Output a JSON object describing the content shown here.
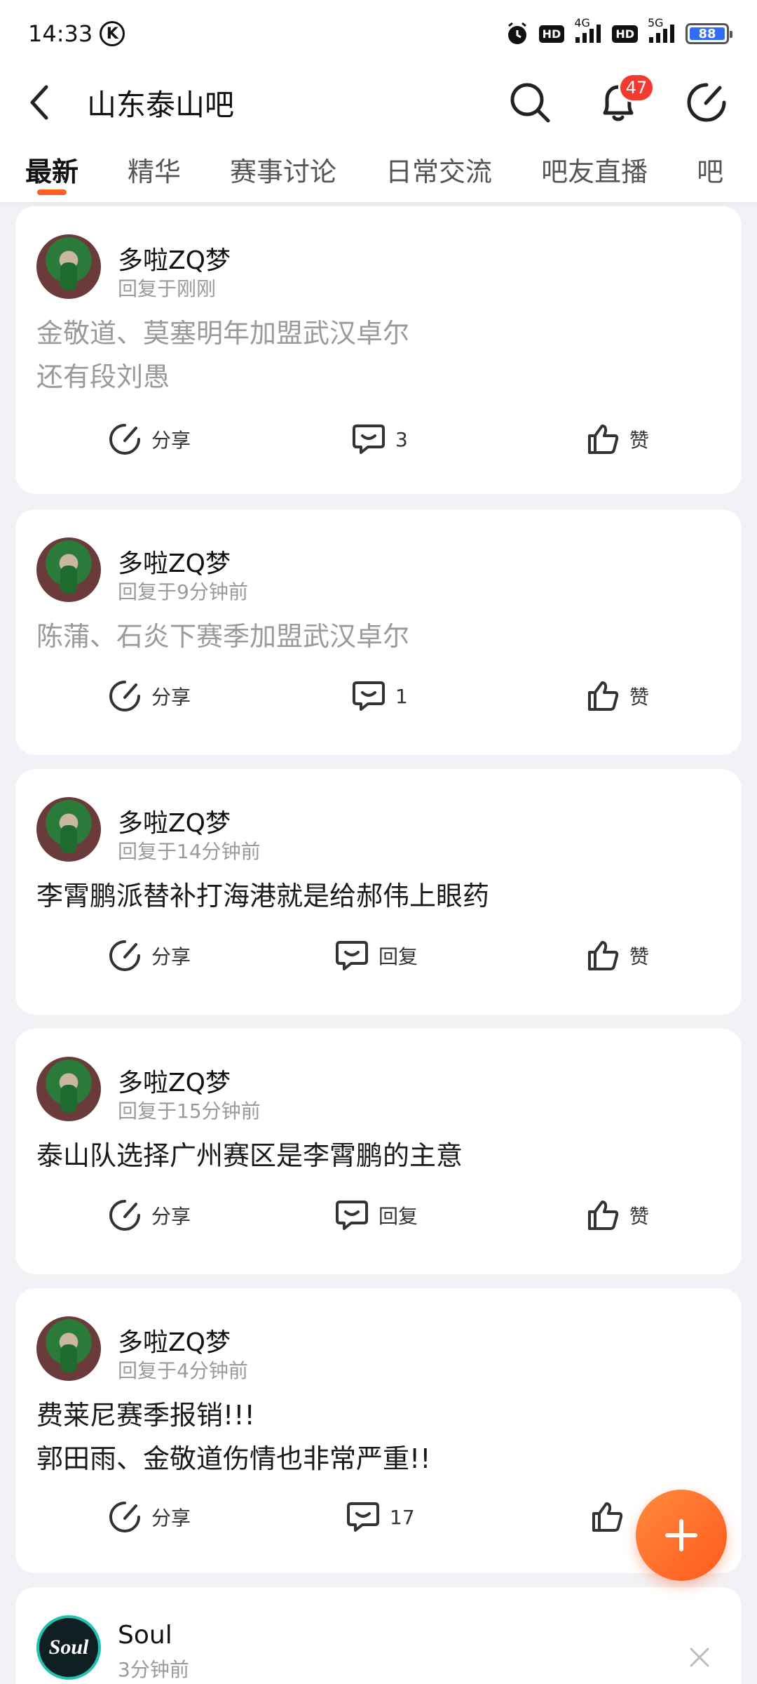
{
  "status_bar": {
    "time": "14:33",
    "k_badge": "K",
    "hd1": "HD",
    "net1": "4G",
    "hd2": "HD",
    "net2": "5G",
    "battery": "88"
  },
  "header": {
    "title": "山东泰山吧",
    "notification_count": "47"
  },
  "tabs": [
    "最新",
    "精华",
    "赛事讨论",
    "日常交流",
    "吧友直播",
    "吧"
  ],
  "posts": [
    {
      "username": "多啦ZQ梦",
      "meta": "回复于刚刚",
      "lines": [
        "金敬道、莫塞明年加盟武汉卓尔",
        "还有段刘愚"
      ],
      "share": "分享",
      "comment": "3",
      "like": "赞"
    },
    {
      "username": "多啦ZQ梦",
      "meta": "回复于9分钟前",
      "lines": [
        "陈蒲、石炎下赛季加盟武汉卓尔"
      ],
      "share": "分享",
      "comment": "1",
      "like": "赞"
    },
    {
      "username": "多啦ZQ梦",
      "meta": "回复于14分钟前",
      "lines": [
        "李霄鹏派替补打海港就是给郝伟上眼药"
      ],
      "share": "分享",
      "comment": "回复",
      "like": "赞"
    },
    {
      "username": "多啦ZQ梦",
      "meta": "回复于15分钟前",
      "lines": [
        "泰山队选择广州赛区是李霄鹏的主意"
      ],
      "share": "分享",
      "comment": "回复",
      "like": "赞"
    },
    {
      "username": "多啦ZQ梦",
      "meta": "回复于4分钟前",
      "lines": [
        "费莱尼赛季报销!!!",
        "郭田雨、金敬道伤情也非常严重!!"
      ],
      "share": "分享",
      "comment": "17",
      "like": ""
    }
  ],
  "ad": {
    "username": "Soul",
    "meta": "3分钟前",
    "avatar_text": "Soul"
  }
}
